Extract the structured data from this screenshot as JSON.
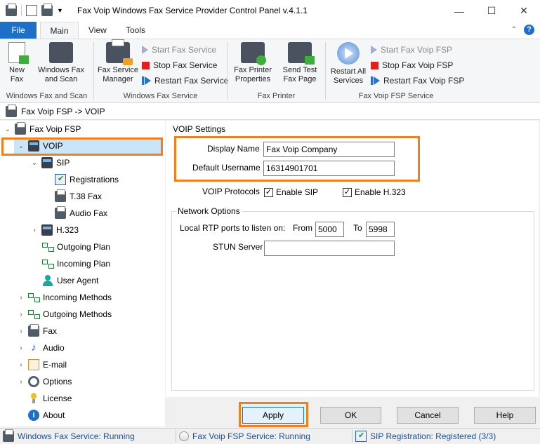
{
  "window": {
    "title": "Fax Voip Windows Fax Service Provider Control Panel v.4.1.1",
    "minimize": "—",
    "maximize": "☐",
    "close": "✕"
  },
  "tabs": {
    "file": "File",
    "main": "Main",
    "view": "View",
    "tools": "Tools"
  },
  "ribbon": {
    "wfs_group": {
      "label": "Windows Fax and Scan",
      "new_fax": "New Fax",
      "windows_fax_scan": "Windows Fax and Scan"
    },
    "service_group": {
      "label": "Windows Fax Service",
      "fax_service_manager": "Fax Service Manager",
      "start": "Start Fax Service",
      "stop": "Stop Fax Service",
      "restart": "Restart Fax Service"
    },
    "printer_group": {
      "label": "Fax Printer",
      "properties": "Fax Printer Properties",
      "send_test": "Send Test Fax Page"
    },
    "fsp_group": {
      "label": "Fax Voip FSP Service",
      "restart_all": "Restart All Services",
      "start": "Start Fax Voip FSP",
      "stop": "Stop Fax Voip FSP",
      "restart": "Restart Fax Voip FSP"
    }
  },
  "breadcrumb": "Fax Voip FSP -> VOIP",
  "tree": {
    "root": "Fax Voip FSP",
    "voip": "VOIP",
    "sip": "SIP",
    "registrations": "Registrations",
    "t38": "T.38 Fax",
    "audio_fax": "Audio Fax",
    "h323": "H.323",
    "outgoing_plan": "Outgoing Plan",
    "incoming_plan": "Incoming Plan",
    "user_agent": "User Agent",
    "incoming_methods": "Incoming Methods",
    "outgoing_methods": "Outgoing Methods",
    "fax": "Fax",
    "audio": "Audio",
    "email": "E-mail",
    "options": "Options",
    "license": "License",
    "about": "About"
  },
  "voip_settings": {
    "legend": "VOIP Settings",
    "display_name_label": "Display Name",
    "display_name_value": "Fax Voip Company",
    "default_username_label": "Default Username",
    "default_username_value": "16314901701",
    "protocols_label": "VOIP Protocols",
    "enable_sip": "Enable SIP",
    "enable_sip_checked": true,
    "enable_h323": "Enable H.323",
    "enable_h323_checked": true
  },
  "network_options": {
    "legend": "Network Options",
    "rtp_label": "Local RTP ports to listen on:",
    "from_label": "From",
    "from_value": "5000",
    "to_label": "To",
    "to_value": "5998",
    "stun_label": "STUN Server",
    "stun_value": ""
  },
  "buttons": {
    "apply": "Apply",
    "ok": "OK",
    "cancel": "Cancel",
    "help": "Help"
  },
  "status": {
    "fax_service": "Windows Fax Service: Running",
    "fsp_service": "Fax Voip FSP Service: Running",
    "sip_registration": "SIP Registration: Registered (3/3)"
  },
  "colors": {
    "highlight": "#f07f20",
    "file_tab": "#1e6fc7",
    "selection": "#cce4f7"
  }
}
